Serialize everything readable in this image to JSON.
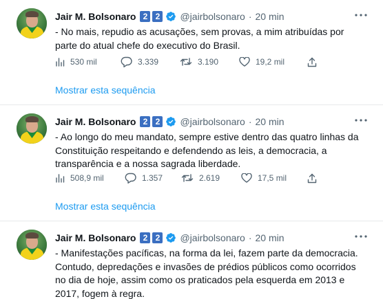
{
  "tweets": [
    {
      "author_name": "Jair M. Bolsonaro",
      "badges": [
        "2",
        "2"
      ],
      "handle": "@jairbolsonaro",
      "separator": "·",
      "time": "20 min",
      "text": "- No mais, repudio as acusações, sem provas, a mim atribuídas por parte do atual chefe do executivo do Brasil.",
      "views": "530 mil",
      "replies": "3.339",
      "retweets": "3.190",
      "likes": "19,2 mil",
      "show_thread": "Mostrar esta sequência"
    },
    {
      "author_name": "Jair M. Bolsonaro",
      "badges": [
        "2",
        "2"
      ],
      "handle": "@jairbolsonaro",
      "separator": "·",
      "time": "20 min",
      "text": "- Ao longo do meu mandato, sempre estive dentro das quatro linhas da Constituição respeitando e defendendo as leis, a democracia, a transparência e a nossa sagrada liberdade.",
      "views": "508,9 mil",
      "replies": "1.357",
      "retweets": "2.619",
      "likes": "17,5 mil",
      "show_thread": "Mostrar esta sequência"
    },
    {
      "author_name": "Jair M. Bolsonaro",
      "badges": [
        "2",
        "2"
      ],
      "handle": "@jairbolsonaro",
      "separator": "·",
      "time": "20 min",
      "text": "- Manifestações pacíficas, na forma da lei, fazem parte da democracia. Contudo, depredações e invasões de prédios públicos como ocorridos no dia de hoje, assim como os praticados pela esquerda em 2013 e 2017, fogem à regra."
    }
  ],
  "icons": {
    "verified": "verified-badge-icon",
    "more": "more-horizontal-icon",
    "views": "analytics-icon",
    "reply": "reply-icon",
    "retweet": "retweet-icon",
    "like": "heart-icon",
    "share": "share-icon"
  },
  "colors": {
    "accent": "#1d9bf0",
    "badge": "#3b6fc1",
    "secondary_text": "#536471",
    "divider": "#e7e9ea"
  }
}
